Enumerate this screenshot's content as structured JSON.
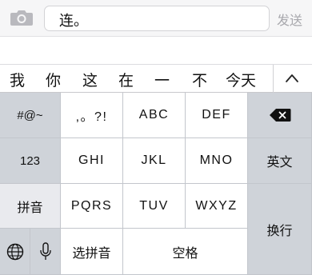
{
  "input": {
    "text": "连。",
    "send_label": "发送"
  },
  "candidates": [
    "我",
    "你",
    "这",
    "在",
    "一",
    "不",
    "今天"
  ],
  "keyboard": {
    "symbols_label": "#@~",
    "punct_label": ",。?!",
    "abc_label": "ABC",
    "def_label": "DEF",
    "num_label": "123",
    "ghi_label": "GHI",
    "jkl_label": "JKL",
    "mno_label": "MNO",
    "english_label": "英文",
    "pinyin_label": "拼音",
    "pqrs_label": "PQRS",
    "tuv_label": "TUV",
    "wxyz_label": "WXYZ",
    "return_label": "换行",
    "select_pinyin_label": "选拼音",
    "space_label": "空格"
  }
}
